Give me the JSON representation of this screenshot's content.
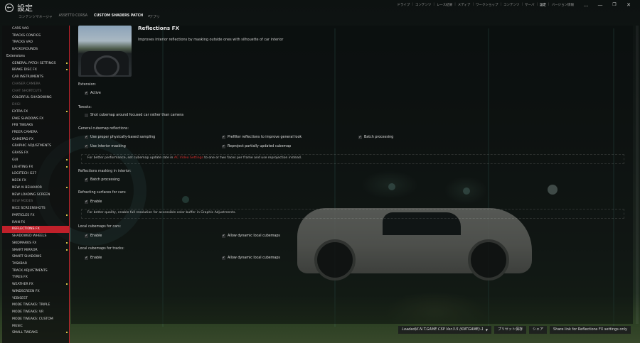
{
  "window": {
    "title": "設定",
    "controls": [
      "...",
      "—",
      "❐",
      "✕"
    ]
  },
  "top_tabs": [
    {
      "label": "コンテンツマネージャ",
      "active": false
    },
    {
      "label": "ASSETTO CORSA",
      "active": false
    },
    {
      "label": "CUSTOM SHADERS PATCH",
      "active": true
    },
    {
      "label": "アプリ",
      "active": false
    }
  ],
  "top_nav": [
    "ドライブ",
    "コンテンツ",
    "レース結果",
    "メディア",
    "ワークショップ",
    "コンテンツ",
    "サーバ",
    "設定",
    "バージョン情報"
  ],
  "top_nav_active": "設定",
  "sidebar": {
    "items": [
      {
        "label": "CARS VAO"
      },
      {
        "label": "TRACKS CONFIGS"
      },
      {
        "label": "TRACKS VAO"
      },
      {
        "label": "BACKGROUNDS"
      },
      {
        "label": "Extensions",
        "section": true
      },
      {
        "label": "GENERAL PATCH SETTINGS",
        "dot": true
      },
      {
        "label": "BRAKE DISC FX",
        "dot": true
      },
      {
        "label": "CAR INSTRUMENTS"
      },
      {
        "label": "CHASER CAMERA",
        "dim": true
      },
      {
        "label": "CHAT SHORTCUTS",
        "dim": true
      },
      {
        "label": "COLORFUL SHADOWING"
      },
      {
        "label": "DXGI",
        "dim": true
      },
      {
        "label": "EXTRA FX",
        "dot": true
      },
      {
        "label": "FAKE SHADOWS FX"
      },
      {
        "label": "FFB TWEAKS"
      },
      {
        "label": "FREER CAMERA"
      },
      {
        "label": "GAMEPAD FX"
      },
      {
        "label": "GRAPHIC ADJUSTMENTS"
      },
      {
        "label": "GRASS FX"
      },
      {
        "label": "GUI",
        "dot": true
      },
      {
        "label": "LIGHTING FX",
        "dot": true
      },
      {
        "label": "LOGITECH G27"
      },
      {
        "label": "NECK FX"
      },
      {
        "label": "NEW AI BEHAVIOR",
        "dot": true
      },
      {
        "label": "NEW LOADING SCREEN"
      },
      {
        "label": "NEW MODES",
        "dim": true
      },
      {
        "label": "NICE SCREENSHOTS"
      },
      {
        "label": "PARTICLES FX",
        "dot": true
      },
      {
        "label": "RAIN FX"
      },
      {
        "label": "REFLECTIONS FX",
        "selected": true
      },
      {
        "label": "SHADOWED WHEELS"
      },
      {
        "label": "SKIDMARKS FX",
        "dot": true
      },
      {
        "label": "SMART MIRROR",
        "dot": true
      },
      {
        "label": "SMART SHADOWS"
      },
      {
        "label": "TASKBAR"
      },
      {
        "label": "TRACK ADJUSTMENTS"
      },
      {
        "label": "TYRES FX"
      },
      {
        "label": "WEATHER FX",
        "dot": true
      },
      {
        "label": "WINDSCREEN FX"
      },
      {
        "label": "YEBISEST"
      },
      {
        "label": "MODE TWEAKS: TRIPLE"
      },
      {
        "label": "MODE TWEAKS: VR"
      },
      {
        "label": "MODE TWEAKS: CUSTOM"
      },
      {
        "label": "MUSIC"
      },
      {
        "label": "SMALL TWEAKS",
        "dot": true
      }
    ]
  },
  "content": {
    "title": "Reflections FX",
    "description": "Improves interior reflections by masking outside ones with silhouette of car interior",
    "extension_label": "Extension:",
    "active_label": "Active",
    "tweaks_label": "Tweaks:",
    "tweak_shot_cubemap": "Shot cubemap around focused car rather than camera",
    "general_label": "General cubemap reflections:",
    "general_options": {
      "proper_sampling": "Use proper physically-based sampling",
      "prefilter": "Prefilter reflections to improve general look",
      "batch_processing": "Batch processing",
      "interior_masking": "Use interior masking",
      "reproject": "Reproject partially updated cubemap"
    },
    "performance_note_pre": "For better performance, set cubemap update rate in",
    "performance_note_link": "AC Video Settings",
    "performance_note_post": "to one or two faces per frame and use reprojection instead.",
    "masking_label": "Reflections masking in interior:",
    "masking_batch": "Batch processing",
    "refracting_label": "Refracting surfaces for cars:",
    "refracting_enable": "Enable",
    "quality_note": "For better quality, enable full resolution for accessible color buffer in Graphic Adjustments.",
    "local_cars_label": "Local cubemaps for cars:",
    "local_cars_enable": "Enable",
    "local_cars_dynamic": "Allow dynamic local cubemaps",
    "local_tracks_label": "Local cubemaps for tracks:",
    "local_tracks_enable": "Enable",
    "local_tracks_dynamic": "Allow dynamic local cubemaps"
  },
  "bottom": {
    "preset_selected": "Loaded\\K.N.T.GAME CSP Ver.3.5 (KNTGAME)-1",
    "save_preset": "プリセット保存",
    "share": "シェア",
    "share_link": "Share link for Reflections FX settings only"
  },
  "colors": {
    "accent_red": "#c0202a",
    "link_red": "#d62b2b",
    "dot_yellow": "#d4c24a"
  }
}
